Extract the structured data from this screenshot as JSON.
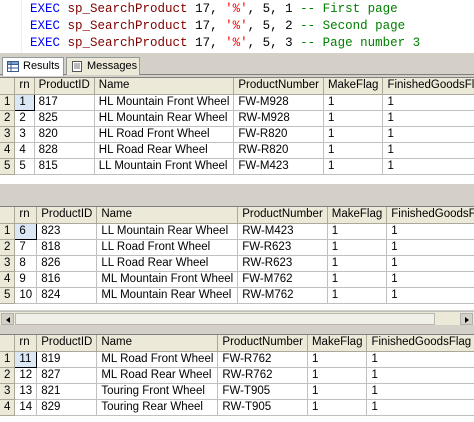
{
  "editor": {
    "lines": [
      {
        "keyword": "EXEC",
        "proc": "sp_SearchProduct",
        "args_pre": " 17, ",
        "str": "'%'",
        "args_post": ", 5, 1 ",
        "comment": "-- First page"
      },
      {
        "keyword": "EXEC",
        "proc": "sp_SearchProduct",
        "args_pre": " 17, ",
        "str": "'%'",
        "args_post": ", 5, 2 ",
        "comment": "-- Second page"
      },
      {
        "keyword": "EXEC",
        "proc": "sp_SearchProduct",
        "args_pre": " 17, ",
        "str": "'%'",
        "args_post": ", 5, 3 ",
        "comment": "-- Page number 3"
      }
    ]
  },
  "tabs": [
    {
      "label": "Results",
      "icon": "grid-icon"
    },
    {
      "label": "Messages",
      "icon": "messages-icon"
    }
  ],
  "grids": [
    {
      "headers": [
        "rn",
        "ProductID",
        "Name",
        "ProductNumber",
        "MakeFlag",
        "FinishedGoodsFlag"
      ],
      "rows": [
        {
          "num": "1",
          "cells": [
            "1",
            "817",
            "HL Mountain Front Wheel",
            "FW-M928",
            "1",
            "1"
          ]
        },
        {
          "num": "2",
          "cells": [
            "2",
            "825",
            "HL Mountain Rear Wheel",
            "RW-M928",
            "1",
            "1"
          ]
        },
        {
          "num": "3",
          "cells": [
            "3",
            "820",
            "HL Road Front Wheel",
            "FW-R820",
            "1",
            "1"
          ]
        },
        {
          "num": "4",
          "cells": [
            "4",
            "828",
            "HL Road Rear Wheel",
            "RW-R820",
            "1",
            "1"
          ]
        },
        {
          "num": "5",
          "cells": [
            "5",
            "815",
            "LL Mountain Front Wheel",
            "FW-M423",
            "1",
            "1"
          ]
        }
      ]
    },
    {
      "headers": [
        "rn",
        "ProductID",
        "Name",
        "ProductNumber",
        "MakeFlag",
        "FinishedGoodsFlag"
      ],
      "rows": [
        {
          "num": "1",
          "cells": [
            "6",
            "823",
            "LL Mountain Rear Wheel",
            "RW-M423",
            "1",
            "1"
          ]
        },
        {
          "num": "2",
          "cells": [
            "7",
            "818",
            "LL Road Front Wheel",
            "FW-R623",
            "1",
            "1"
          ]
        },
        {
          "num": "3",
          "cells": [
            "8",
            "826",
            "LL Road Rear Wheel",
            "RW-R623",
            "1",
            "1"
          ]
        },
        {
          "num": "4",
          "cells": [
            "9",
            "816",
            "ML Mountain Front Wheel",
            "FW-M762",
            "1",
            "1"
          ]
        },
        {
          "num": "5",
          "cells": [
            "10",
            "824",
            "ML Mountain Rear Wheel",
            "RW-M762",
            "1",
            "1"
          ]
        }
      ]
    },
    {
      "headers": [
        "rn",
        "ProductID",
        "Name",
        "ProductNumber",
        "MakeFlag",
        "FinishedGoodsFlag"
      ],
      "rows": [
        {
          "num": "1",
          "cells": [
            "11",
            "819",
            "ML Road Front Wheel",
            "FW-R762",
            "1",
            "1"
          ]
        },
        {
          "num": "2",
          "cells": [
            "12",
            "827",
            "ML Road Rear Wheel",
            "RW-R762",
            "1",
            "1"
          ]
        },
        {
          "num": "3",
          "cells": [
            "13",
            "821",
            "Touring Front Wheel",
            "FW-T905",
            "1",
            "1"
          ]
        },
        {
          "num": "4",
          "cells": [
            "14",
            "829",
            "Touring Rear Wheel",
            "RW-T905",
            "1",
            "1"
          ]
        }
      ]
    }
  ]
}
